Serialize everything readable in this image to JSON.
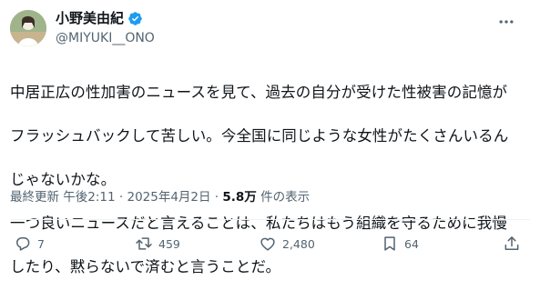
{
  "author": {
    "display_name": "小野美由紀",
    "handle": "@MIYUKI__ONO",
    "verified": true
  },
  "tweet": {
    "text": "中居正広の性加害のニュースを見て、過去の自分が受けた性被害の記憶がフラッシュバックして苦しい。今全国に同じような女性がたくさんいるんじゃないかな。\n一つ良いニュースだと言えることは、私たちはもう組織を守るために我慢したり、黙らないで済むと言うことだ。",
    "lines": [
      "中居正広の性加害のニュースを見て、過去の自分が受けた性被害の記憶が",
      "フラッシュバックして苦しい。今全国に同じような女性がたくさんいるん",
      "じゃないかな。",
      "一つ良いニュースだと言えることは、私たちはもう組織を守るために我慢",
      "したり、黙らないで済むと言うことだ。"
    ]
  },
  "meta": {
    "updated_label": "最終更新 午後2:11 · 2025年4月2日 · ",
    "views_count": "5.8万",
    "views_suffix": " 件の表示"
  },
  "actions": {
    "replies": "7",
    "retweets": "459",
    "likes": "2,480",
    "bookmarks": "64"
  },
  "colors": {
    "text": "#0f1419",
    "secondary": "#536471",
    "verified": "#1d9bf0",
    "divider": "#eff3f4"
  },
  "icons": [
    "more-icon",
    "verified-badge-icon",
    "reply-icon",
    "retweet-icon",
    "like-icon",
    "bookmark-icon",
    "share-icon"
  ]
}
